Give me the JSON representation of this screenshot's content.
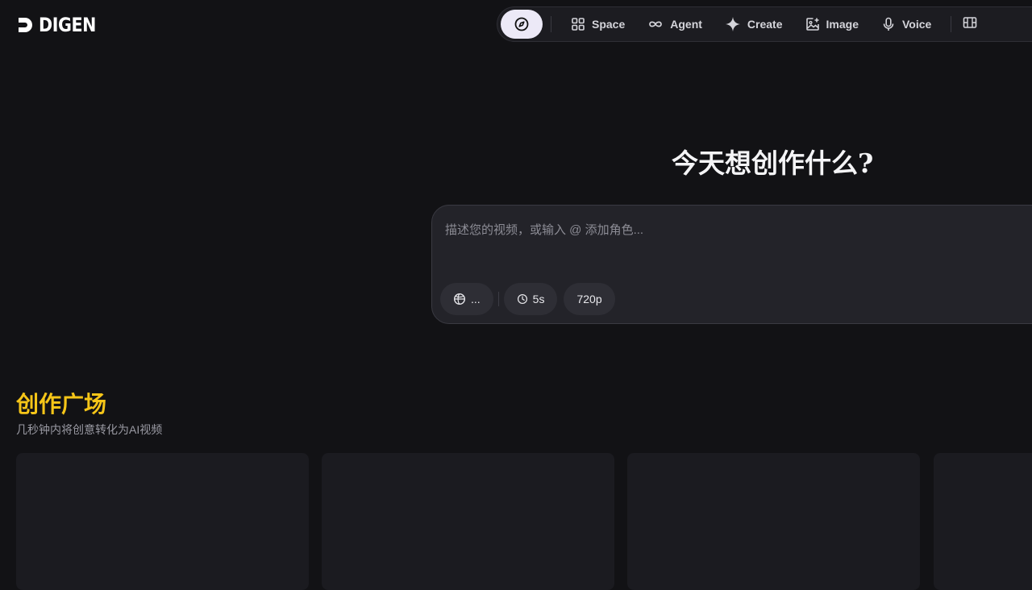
{
  "brand": {
    "name": "DIGEN"
  },
  "nav": {
    "home_icon": "compass-icon",
    "items": [
      {
        "label": "Space",
        "icon": "grid-icon"
      },
      {
        "label": "Agent",
        "icon": "infinity-icon"
      },
      {
        "label": "Create",
        "icon": "sparkle-icon"
      },
      {
        "label": "Image",
        "icon": "image-icon"
      },
      {
        "label": "Voice",
        "icon": "mic-icon"
      }
    ],
    "tail_icon": "film-icon"
  },
  "hero": {
    "title": "今天想创作什么?"
  },
  "prompt": {
    "placeholder": "描述您的视频，或输入 @ 添加角色...",
    "model_chip": "...",
    "duration_chip": "5s",
    "resolution_chip": "720p"
  },
  "gallery": {
    "title": "创作广场",
    "subtitle": "几秒钟内将创意转化为AI视频"
  },
  "colors": {
    "background": "#121215",
    "accent": "#f5c518",
    "home_pill": "#ece9f7"
  }
}
